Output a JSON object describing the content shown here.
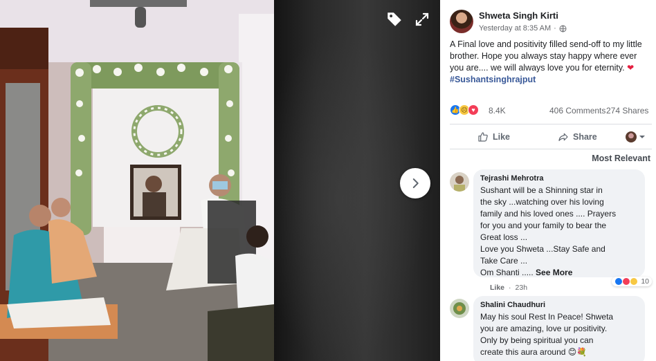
{
  "viewer": {
    "tag_icon": "tag-icon",
    "expand_icon": "expand-icon",
    "next_icon": "chevron-right-icon"
  },
  "post": {
    "author": "Shweta Singh Kirti",
    "timestamp": "Yesterday at 8:35 AM",
    "privacy_icon": "globe-icon",
    "text": "A Final love and positivity filled send-off to my little brother. Hope you always stay happy where ever you are.... we will always love you for eternity.",
    "hashtag": "#Sushantsinghrajput",
    "reaction_count": "8.4K",
    "comment_count": "406 Comments",
    "share_count": "274 Shares",
    "like_label": "Like",
    "share_label": "Share",
    "sort_label": "Most Relevant"
  },
  "comments": [
    {
      "name": "Tejrashi Mehrotra",
      "lines": [
        "Sushant will be a Shinning star in",
        "the sky ...watching over his loving",
        "family and his loved ones .... Prayers",
        "for you and your family to bear the",
        "Great loss ...",
        "Love you Shweta ...Stay Safe and",
        "Take Care ...",
        "Om Shanti ....."
      ],
      "see_more": "See More",
      "like_label": "Like",
      "age": "23h",
      "reaction_count": "10"
    },
    {
      "name": "Shalini Chaudhuri",
      "lines": [
        "May his soul Rest In Peace! Shweta",
        "you are amazing, love ur positivity.",
        "Only by being spiritual you can",
        "create this aura around"
      ]
    }
  ],
  "colors": {
    "accent": "#1877f2",
    "love": "#f33e58",
    "hashtag": "#385898"
  }
}
